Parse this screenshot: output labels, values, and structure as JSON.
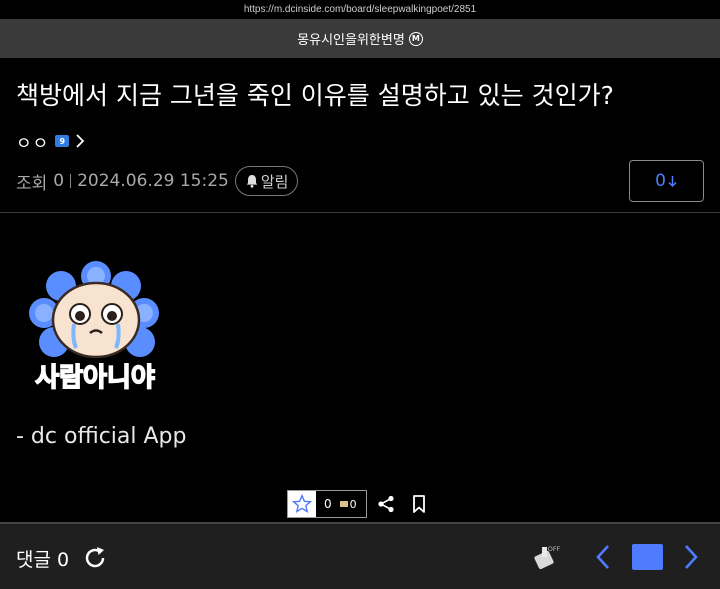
{
  "browser": {
    "url": "https://m.dcinside.com/board/sleepwalkingpoet/2851"
  },
  "gallery": {
    "name": "몽유시인을위한변명",
    "badge": "M"
  },
  "post": {
    "title": "책방에서 지금 그년을 죽인 이유를 설명하고 있는 것인가?",
    "author": "ㅇㅇ",
    "author_badge": "9",
    "views_label": "조회",
    "views": "0",
    "date": "2024.06.29 15:25",
    "alarm_label": "알림",
    "comment_jump_count": "0",
    "sticker_text": "사람아니야",
    "body_text": "- dc official App"
  },
  "reactions": {
    "recommend_count": "0",
    "image_recommend_count": "0"
  },
  "bottom": {
    "comment_label": "댓글",
    "comment_count": "0",
    "ai_toggle": "OFF"
  },
  "colors": {
    "accent": "#4f7cff",
    "background": "#000000",
    "bar": "#3a3a3a",
    "bottom_bar": "#1f1f1f"
  },
  "icons": [
    "star-icon",
    "share-icon",
    "bookmark-icon",
    "refresh-icon",
    "bell-icon",
    "chevron-left-icon",
    "chevron-right-icon",
    "list-icon",
    "ai-off-icon"
  ]
}
